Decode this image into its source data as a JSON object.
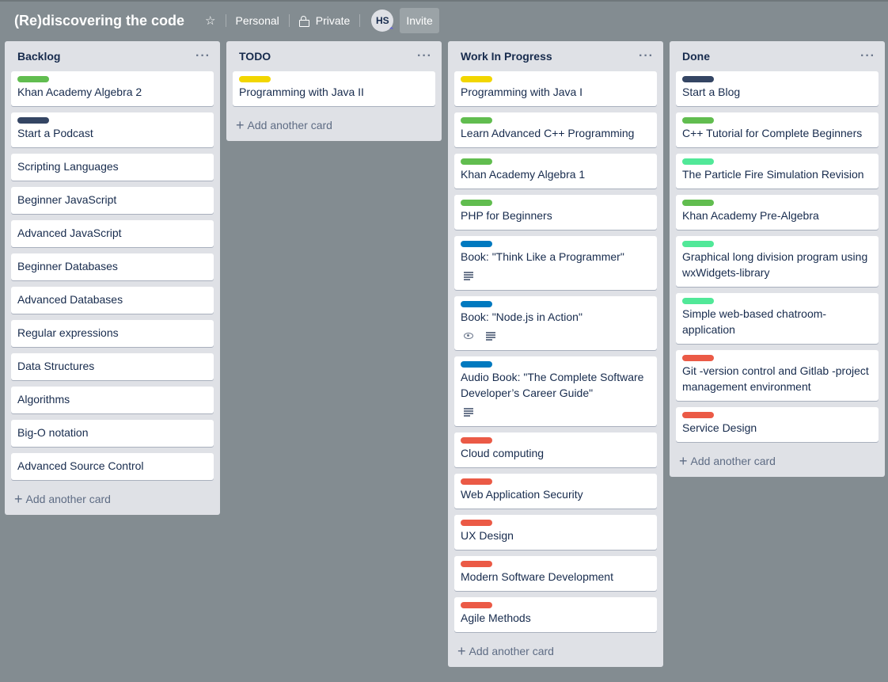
{
  "header": {
    "board_title": "(Re)discovering the code",
    "star_icon": "star-icon",
    "team_label": "Personal",
    "visibility_icon": "lock-icon",
    "visibility_label": "Private",
    "avatar_initials": "HS",
    "avatar_badge_icon": "admin-chevron-icon",
    "invite_label": "Invite"
  },
  "label_colors": {
    "green": "#61bd4f",
    "yellow": "#f2d600",
    "navy": "#344563",
    "blue": "#0079bf",
    "lime": "#51e898",
    "red": "#eb5a46"
  },
  "add_card_label": "Add another card",
  "lists": [
    {
      "title": "Backlog",
      "cards": [
        {
          "title": "Khan Academy Algebra 2",
          "label": "green"
        },
        {
          "title": "Start a Podcast",
          "label": "navy"
        },
        {
          "title": "Scripting Languages"
        },
        {
          "title": "Beginner JavaScript"
        },
        {
          "title": "Advanced JavaScript"
        },
        {
          "title": "Beginner Databases"
        },
        {
          "title": "Advanced Databases"
        },
        {
          "title": "Regular expressions"
        },
        {
          "title": "Data Structures"
        },
        {
          "title": "Algorithms"
        },
        {
          "title": "Big-O notation"
        },
        {
          "title": "Advanced Source Control"
        }
      ]
    },
    {
      "title": "TODO",
      "cards": [
        {
          "title": "Programming with Java II",
          "label": "yellow"
        }
      ]
    },
    {
      "title": "Work In Progress",
      "cards": [
        {
          "title": "Programming with Java I",
          "label": "yellow"
        },
        {
          "title": "Learn Advanced C++ Programming",
          "label": "green"
        },
        {
          "title": "Khan Academy Algebra 1",
          "label": "green"
        },
        {
          "title": "PHP for Beginners",
          "label": "green"
        },
        {
          "title": "Book: \"Think Like a Programmer\"",
          "label": "blue",
          "badges": [
            "description"
          ]
        },
        {
          "title": "Book: \"Node.js in Action\"",
          "label": "blue",
          "badges": [
            "watching",
            "description"
          ]
        },
        {
          "title": "Audio Book: \"The Complete Software Developer’s Career Guide\"",
          "label": "blue",
          "badges": [
            "description"
          ]
        },
        {
          "title": "Cloud computing",
          "label": "red"
        },
        {
          "title": "Web Application Security",
          "label": "red"
        },
        {
          "title": "UX Design",
          "label": "red"
        },
        {
          "title": "Modern Software Development",
          "label": "red"
        },
        {
          "title": "Agile Methods",
          "label": "red"
        }
      ]
    },
    {
      "title": "Done",
      "cards": [
        {
          "title": "Start a Blog",
          "label": "navy"
        },
        {
          "title": "C++ Tutorial for Complete Beginners",
          "label": "green"
        },
        {
          "title": "The Particle Fire Simulation Revision",
          "label": "lime"
        },
        {
          "title": "Khan Academy Pre-Algebra",
          "label": "green"
        },
        {
          "title": "Graphical long division program using wxWidgets-library",
          "label": "lime"
        },
        {
          "title": "Simple web-based chatroom-application",
          "label": "lime"
        },
        {
          "title": "Git -version control and Gitlab -project management environment",
          "label": "red"
        },
        {
          "title": "Service Design",
          "label": "red"
        }
      ]
    }
  ]
}
